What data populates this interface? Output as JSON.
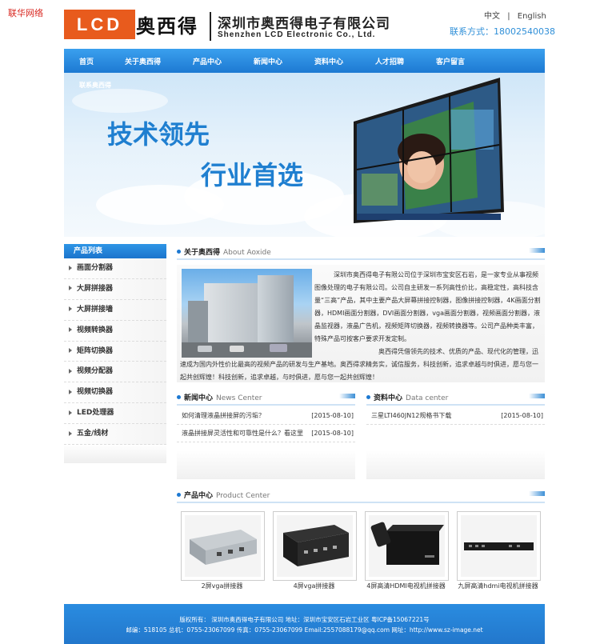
{
  "top_link": "联华网络",
  "logo": {
    "text": "LCD",
    "cn": "奥西得"
  },
  "company": {
    "cn": "深圳市奥西得电子有限公司",
    "en": "Shenzhen LCD Electronic Co., Ltd."
  },
  "lang": {
    "cn": "中文",
    "sep": "|",
    "en": "English"
  },
  "contact": "联系方式：18002540038",
  "nav": [
    "首页",
    "关于奥西得",
    "产品中心",
    "新闻中心",
    "资料中心",
    "人才招聘",
    "客户留言"
  ],
  "banner": {
    "sub": "联系奥西得",
    "slogan1": "技术领先",
    "slogan2": "行业首选"
  },
  "sidebar": {
    "title": "产品列表",
    "items": [
      "画面分割器",
      "大屏拼接器",
      "大屏拼接墙",
      "视频转换器",
      "矩阵切换器",
      "视频分配器",
      "视频切换器",
      "LED处理器",
      "五金/线材"
    ]
  },
  "about": {
    "title": "关于奥西得",
    "title_en": "About Aoxide",
    "p1": "深圳市奥西得电子有限公司位于深圳市宝安区石岩，是一家专业从事视频图像处理的电子有限公司。公司自主研发一系列高性价比，高稳定性，高科技含量“三高”产品，其中主要产品大屏幕拼接控制器，图像拼接控制器，4K画面分割器，HDMI画面分割器，DVI画面分割器，vga画面分割器，视频画面分割器，液晶监视器，液晶广告机，视频矩阵切换器，视频转换器等。公司产品种类丰富，特殊产品可按客户要求开发定制。",
    "p2": "奥西得凭借领先的技术、优质的产品、现代化的管理，迅速成为国内外性价比最高的视频产品的研发与生产基地。奥西得求精务实，诚信服务，科技创新，追求卓越与时俱进，愿与您一起共创辉煌！科技创新，追求卓越，与时俱进，愿与您一起共创辉煌！"
  },
  "news": {
    "title": "新闻中心",
    "title_en": "News Center",
    "items": [
      {
        "title": "如何清理液晶拼接屏的污垢？",
        "date": "[2015-08-10]"
      },
      {
        "title": "液晶拼接屏灵活性和可靠性是什么？看这里",
        "date": "[2015-08-10]"
      }
    ]
  },
  "data_center": {
    "title": "资料中心",
    "title_en": "Data center",
    "items": [
      {
        "title": "三星LTI460JN12规格书下载",
        "date": "[2015-08-10]"
      }
    ]
  },
  "products": {
    "title": "产品中心",
    "title_en": "Product Center",
    "items": [
      {
        "name": "2屏vga拼接器"
      },
      {
        "name": "4屏vga拼接器"
      },
      {
        "name": "4屏高清HDMI电视机拼接器"
      },
      {
        "name": "九屏高清hdmi电视机拼接器"
      }
    ]
  },
  "footer": {
    "line1": "版权所有： 深圳市奥西得电子有限公司 地址：深圳市宝安区石岩工业区 粤ICP备15067221号",
    "line2": "邮编：518105 总机：0755-23067099 传真：0755-23067099 Email:2557088179@qq.com 网址：http://www.sz-image.net"
  },
  "colors": {
    "brand_orange": "#e85b1d",
    "nav_blue": "#1d79d2",
    "slogan_blue": "#1f7fd0",
    "contact_blue": "#2f8fd8"
  }
}
